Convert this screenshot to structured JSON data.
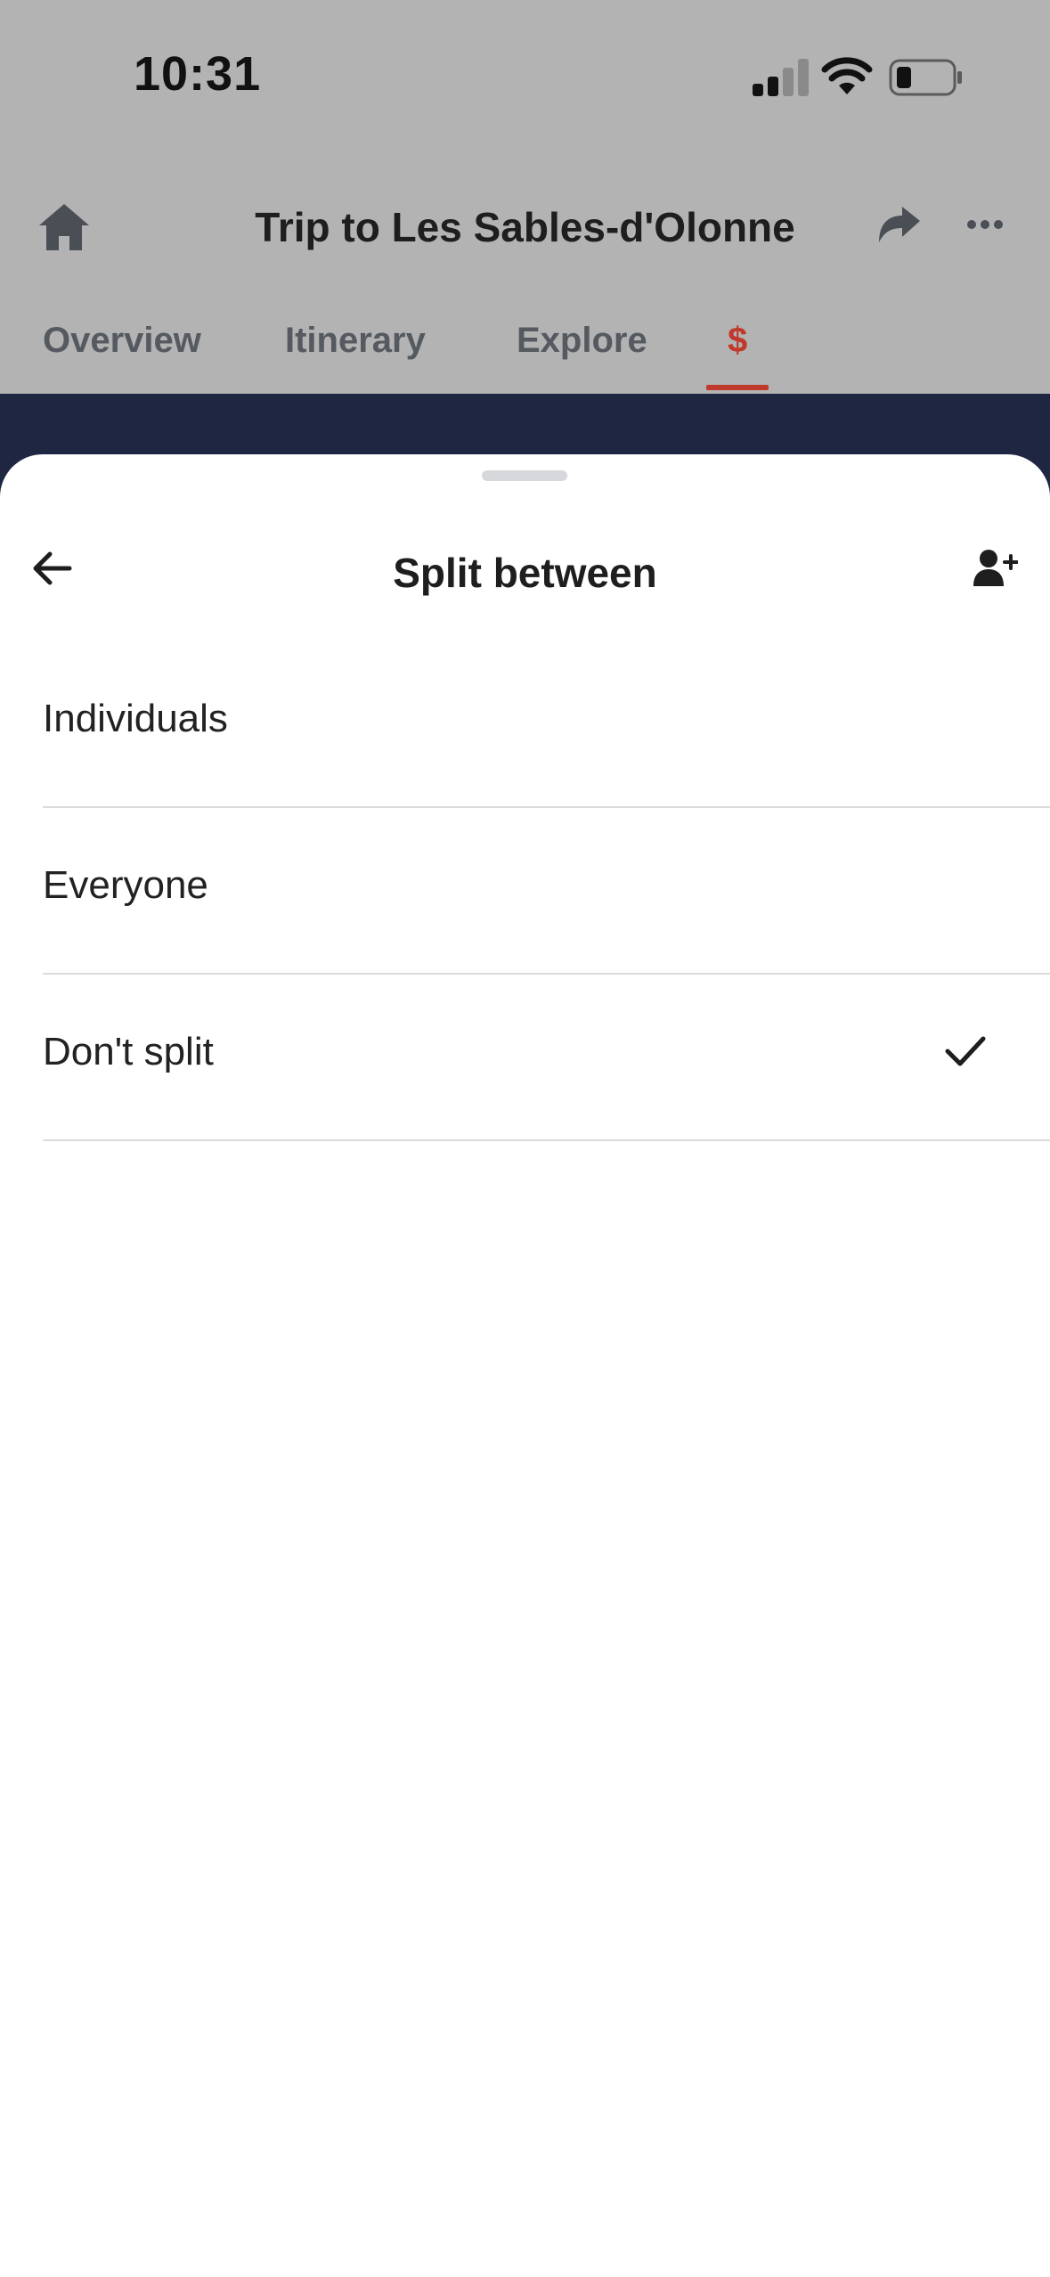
{
  "status_bar": {
    "time": "10:31"
  },
  "header": {
    "title": "Trip to Les Sables-d'Olonne",
    "home_icon": "home-icon",
    "share_icon": "share-icon",
    "more_icon": "more-icon"
  },
  "tabs": [
    {
      "label": "Overview"
    },
    {
      "label": "Itinerary"
    },
    {
      "label": "Explore"
    },
    {
      "label": "$",
      "active": true
    }
  ],
  "sheet": {
    "title": "Split between",
    "back_icon": "back-arrow-icon",
    "add_user_icon": "add-user-icon",
    "options": [
      {
        "label": "Individuals",
        "selected": false
      },
      {
        "label": "Everyone",
        "selected": false
      },
      {
        "label": "Don't split",
        "selected": true
      }
    ]
  },
  "colors": {
    "accent": "#c0392b",
    "dark_band": "#1f2642",
    "overlay": "#b3b3b3",
    "text": "#1e1e1e"
  }
}
